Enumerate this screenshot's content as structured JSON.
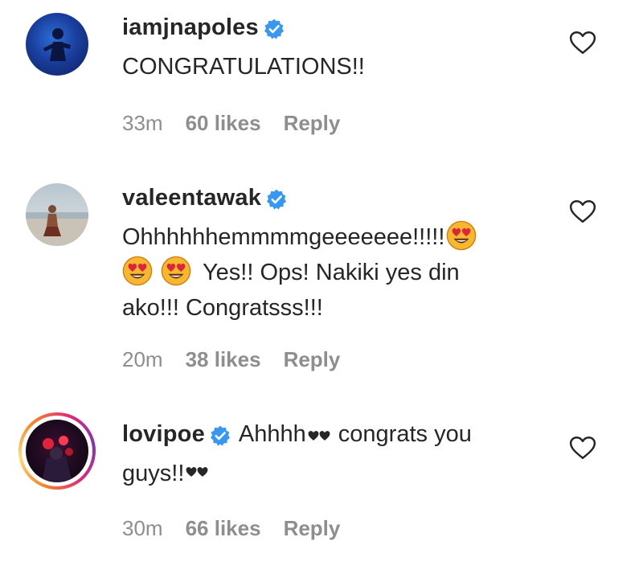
{
  "comments": [
    {
      "username": "iamjnapoles",
      "text": "CONGRATULATIONS!!",
      "time": "33m",
      "likes": "60 likes",
      "reply": "Reply"
    },
    {
      "username": "valeentawak",
      "text_line1": "Ohhhhhhemmmmgeeeeeee!!!!!",
      "text_line2": "Yes!! Ops! Nakiki yes din",
      "text_line3": "ako!!! Congratsss!!!",
      "time": "20m",
      "likes": "38 likes",
      "reply": "Reply"
    },
    {
      "username": "lovipoe",
      "text_line1": "Ahhhh",
      "text_line1b": "congrats you",
      "text_line2": "guys!!",
      "time": "30m",
      "likes": "66 likes",
      "reply": "Reply"
    }
  ],
  "icons": {
    "verified": "verified-badge-icon",
    "like": "heart-outline-icon",
    "emoji": "heart-eyes-emoji",
    "black_heart": "black-heart-icon"
  },
  "colors": {
    "verified_blue": "#3897f0",
    "meta_gray": "#8e8e8e",
    "text": "#262626",
    "story_ring_start": "#f58529",
    "story_ring_end": "#dd2a7b"
  }
}
